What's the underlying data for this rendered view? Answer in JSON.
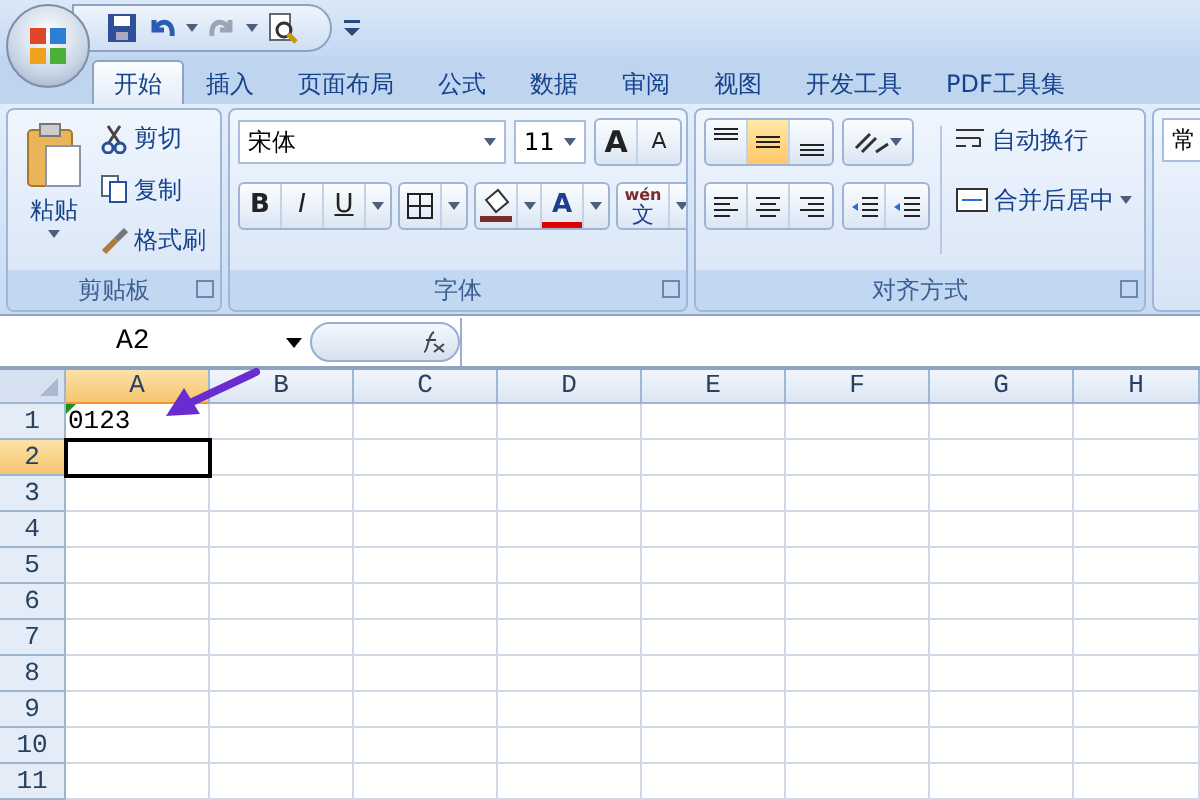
{
  "tabs": [
    {
      "label": "开始",
      "selected": true
    },
    {
      "label": "插入",
      "selected": false
    },
    {
      "label": "页面布局",
      "selected": false
    },
    {
      "label": "公式",
      "selected": false
    },
    {
      "label": "数据",
      "selected": false
    },
    {
      "label": "审阅",
      "selected": false
    },
    {
      "label": "视图",
      "selected": false
    },
    {
      "label": "开发工具",
      "selected": false
    },
    {
      "label": "PDF工具集",
      "selected": false
    }
  ],
  "ribbon": {
    "clipboard": {
      "title": "剪贴板",
      "paste": "粘贴",
      "items": [
        "剪切",
        "复制",
        "格式刷"
      ]
    },
    "font": {
      "title": "字体",
      "font_name": "宋体",
      "font_size": "11",
      "grow": "A",
      "shrink": "A",
      "style_buttons": [
        "B",
        "I",
        "U"
      ],
      "font_color": "A",
      "phonetic_top": "wén",
      "phonetic_bottom": "文"
    },
    "alignment": {
      "title": "对齐方式",
      "vertical": [
        {
          "selected": false
        },
        {
          "selected": true
        },
        {
          "selected": false
        }
      ],
      "wrap": "自动换行",
      "merge": "合并后居中"
    },
    "number": {
      "format": "常"
    }
  },
  "formula_bar": {
    "name_box": "A2"
  },
  "sheet": {
    "columns": [
      {
        "label": "A",
        "selected": true
      },
      {
        "label": "B",
        "selected": false
      },
      {
        "label": "C",
        "selected": false
      },
      {
        "label": "D",
        "selected": false
      },
      {
        "label": "E",
        "selected": false
      },
      {
        "label": "F",
        "selected": false
      },
      {
        "label": "G",
        "selected": false
      },
      {
        "label": "H",
        "selected": false
      }
    ],
    "rows": [
      {
        "label": "1",
        "selected": false,
        "cells": [
          {
            "text": "0123",
            "error_flag": true
          }
        ]
      },
      {
        "label": "2",
        "selected": true
      },
      {
        "label": "3",
        "selected": false
      },
      {
        "label": "4",
        "selected": false
      },
      {
        "label": "5",
        "selected": false
      },
      {
        "label": "6",
        "selected": false
      },
      {
        "label": "7",
        "selected": false
      },
      {
        "label": "8",
        "selected": false
      },
      {
        "label": "9",
        "selected": false
      },
      {
        "label": "10",
        "selected": false
      },
      {
        "label": "11",
        "selected": false
      }
    ]
  }
}
